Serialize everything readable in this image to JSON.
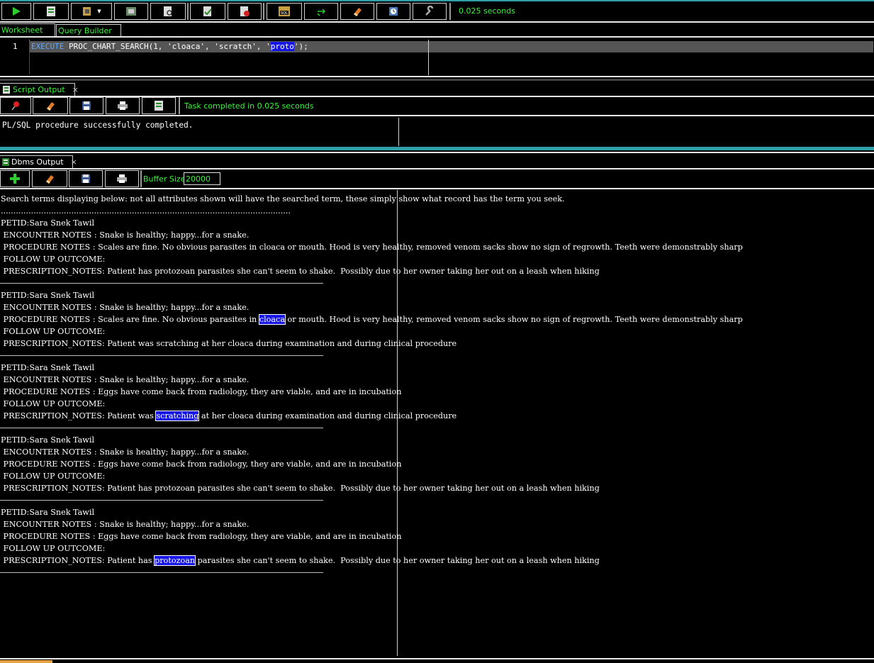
{
  "toolbar": {
    "timing": "0.025 seconds",
    "buttons": [
      "run-statement",
      "run-script",
      "autotrace",
      "explain-plan",
      "sql-tuning",
      "commit",
      "rollback",
      "unshared-sql",
      "sql-history",
      "clear",
      "history-list",
      "tools"
    ]
  },
  "tabs": {
    "worksheet": "Worksheet",
    "query_builder": "Query Builder"
  },
  "editor": {
    "line_number": "1",
    "kw": "EXECUTE",
    "pre_text": " PROC_CHART_SEARCH(1, 'cloaca', 'scratch', '",
    "hl_text": "proto",
    "post_text": "');"
  },
  "script_output": {
    "tab_label": "Script Output",
    "close": "×",
    "status": "Task completed in 0.025 seconds",
    "message": "PL/SQL procedure successfully completed."
  },
  "dbms_output": {
    "tab_label": "Dbms Output",
    "close": "×",
    "buffer_label": "Buffer Size:",
    "buffer_value": "20000",
    "header": "Search terms displaying below: not all attributes shown will have the searched term, these simply show what record has the term you seek.",
    "dots": "...................................................................................................................",
    "records": [
      {
        "petid": "PETID:Sara Snek Tawil",
        "encounter": " ENCOUNTER NOTES : Snake is healthy; happy...for a snake.",
        "procedure_pre": " PROCEDURE NOTES : Scales are fine. No obvious parasites in cloaca or mouth. Hood is very healthy, removed venom sacks show no sign of regrowth. Teeth were demonstrably sharp",
        "procedure_hl": "",
        "procedure_post": "",
        "followup": " FOLLOW UP OUTCOME:",
        "rx_pre": " PRESCRIPTION_NOTES: Patient has protozoan parasites she can't seem to shake.  Possibly due to her owner taking her out on a leash when hiking",
        "rx_hl": "",
        "rx_post": ""
      },
      {
        "petid": "PETID:Sara Snek Tawil",
        "encounter": " ENCOUNTER NOTES : Snake is healthy; happy...for a snake.",
        "procedure_pre": " PROCEDURE NOTES : Scales are fine. No obvious parasites in ",
        "procedure_hl": "cloaca",
        "procedure_post": " or mouth. Hood is very healthy, removed venom sacks show no sign of regrowth. Teeth were demonstrably sharp",
        "followup": " FOLLOW UP OUTCOME:",
        "rx_pre": " PRESCRIPTION_NOTES: Patient was scratching at her cloaca during examination and during clinical procedure",
        "rx_hl": "",
        "rx_post": ""
      },
      {
        "petid": "PETID:Sara Snek Tawil",
        "encounter": " ENCOUNTER NOTES : Snake is healthy; happy...for a snake.",
        "procedure_pre": " PROCEDURE NOTES : Eggs have come back from radiology, they are viable, and are in incubation",
        "procedure_hl": "",
        "procedure_post": "",
        "followup": " FOLLOW UP OUTCOME:",
        "rx_pre": " PRESCRIPTION_NOTES: Patient was ",
        "rx_hl": "scratching",
        "rx_post": " at her cloaca during examination and during clinical procedure"
      },
      {
        "petid": "PETID:Sara Snek Tawil",
        "encounter": " ENCOUNTER NOTES : Snake is healthy; happy...for a snake.",
        "procedure_pre": " PROCEDURE NOTES : Eggs have come back from radiology, they are viable, and are in incubation",
        "procedure_hl": "",
        "procedure_post": "",
        "followup": " FOLLOW UP OUTCOME:",
        "rx_pre": " PRESCRIPTION_NOTES: Patient has protozoan parasites she can't seem to shake.  Possibly due to her owner taking her out on a leash when hiking",
        "rx_hl": "",
        "rx_post": ""
      },
      {
        "petid": "PETID:Sara Snek Tawil",
        "encounter": " ENCOUNTER NOTES : Snake is healthy; happy...for a snake.",
        "procedure_pre": " PROCEDURE NOTES : Eggs have come back from radiology, they are viable, and are in incubation",
        "procedure_hl": "",
        "procedure_post": "",
        "followup": " FOLLOW UP OUTCOME:",
        "rx_pre": " PRESCRIPTION_NOTES: Patient has ",
        "rx_hl": "protozoan",
        "rx_post": " parasites she can't seem to shake.  Possibly due to her owner taking her out on a leash when hiking"
      }
    ]
  }
}
